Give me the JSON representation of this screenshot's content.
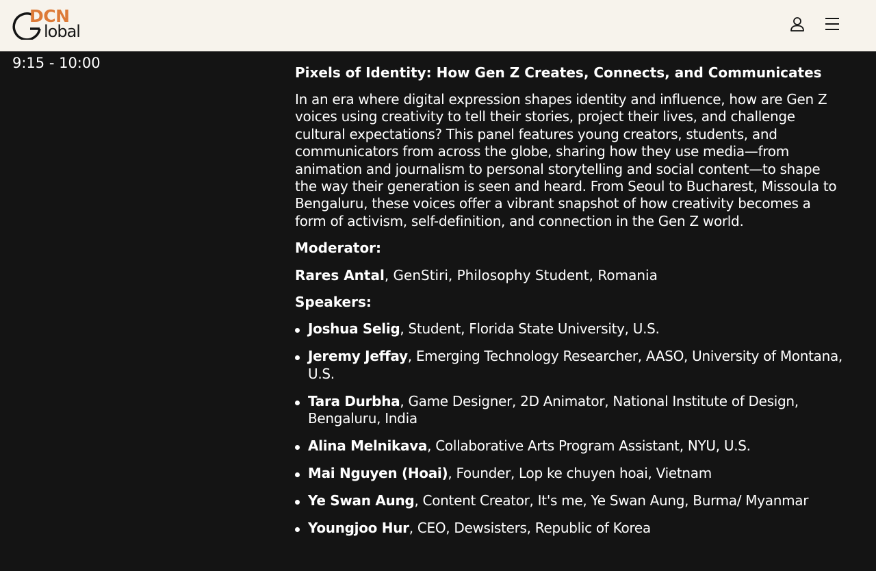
{
  "header": {
    "logo_text_top": "DCN",
    "logo_text_bottom": "lobal",
    "brand_color": "#dd7a37",
    "background_color": "#f7f3ec",
    "icons": [
      "user-icon",
      "hamburger-menu-icon"
    ]
  },
  "session": {
    "time": "9:15 - 10:00",
    "title": "Pixels of Identity: How Gen Z Creates, Connects, and Communicates",
    "description": "In an era where digital expression shapes identity and influence, how are Gen Z voices using creativity to tell their stories, project their lives, and challenge cultural expectations? This panel features young creators, students, and communicators from across the globe, sharing how they use media—from animation and journalism to personal storytelling and social content—to shape the way their generation is seen and heard. From Seoul to Bucharest, Missoula to Bengaluru, these voices offer a vibrant snapshot of how creativity becomes a form of activism, self-definition, and connection in the Gen Z world.",
    "moderator_label": "Moderator:",
    "moderator": {
      "name": "Rares Antal",
      "details": ", GenStiri, Philosophy Student, Romania"
    },
    "speakers_label": "Speakers:",
    "speakers": [
      {
        "name": "Joshua Selig",
        "details": ", Student, Florida State University, U.S."
      },
      {
        "name": "Jeremy Jeffay",
        "details": ", Emerging Technology Researcher, AASO, University of Montana, U.S."
      },
      {
        "name": "Tara Durbha",
        "details": ", Game Designer, 2D Animator, National Institute of Design, Bengaluru, India"
      },
      {
        "name": "Alina Melnikava",
        "details": ", Collaborative Arts Program Assistant, NYU, U.S."
      },
      {
        "name": "Mai Nguyen (Hoai)",
        "details": ", Founder, Lop ke chuyen hoai, Vietnam"
      },
      {
        "name": "Ye Swan Aung",
        "details": ", Content Creator, It's me, Ye Swan Aung, Burma/ Myanmar"
      },
      {
        "name": "Youngjoo Hur",
        "details": ", CEO, Dewsisters, Republic of Korea"
      }
    ]
  }
}
